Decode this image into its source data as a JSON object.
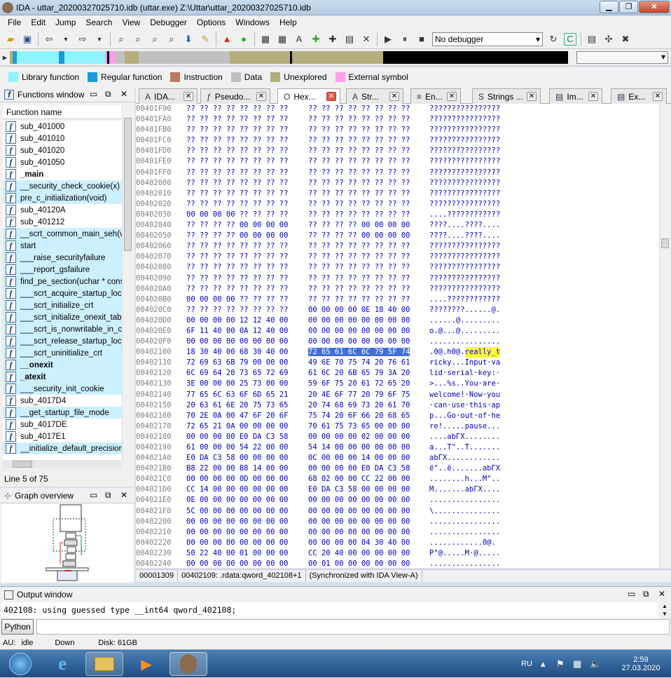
{
  "window": {
    "title": "IDA - uttar_20200327025710.idb (uttar.exe) Z:\\Uttar\\uttar_20200327025710.idb",
    "minimize": "▁",
    "maximize": "❐",
    "close": "✕"
  },
  "menu": [
    "File",
    "Edit",
    "Jump",
    "Search",
    "View",
    "Debugger",
    "Options",
    "Windows",
    "Help"
  ],
  "toolbar": {
    "debugger": "No debugger"
  },
  "legend": [
    {
      "label": "Library function",
      "color": "#8ff3ff"
    },
    {
      "label": "Regular function",
      "color": "#1a9bdc"
    },
    {
      "label": "Instruction",
      "color": "#b87a62"
    },
    {
      "label": "Data",
      "color": "#c0c0c0"
    },
    {
      "label": "Unexplored",
      "color": "#b3ae7b"
    },
    {
      "label": "External symbol",
      "color": "#ff9ee8"
    }
  ],
  "functions_window": {
    "title": "Functions window",
    "column": "Function name",
    "line_count": "Line 5 of 75",
    "items": [
      {
        "name": "sub_401000",
        "bold": false,
        "lib": false
      },
      {
        "name": "sub_401010",
        "bold": false,
        "lib": false
      },
      {
        "name": "sub_401020",
        "bold": false,
        "lib": false
      },
      {
        "name": "sub_401050",
        "bold": false,
        "lib": false
      },
      {
        "name": "_main",
        "bold": true,
        "lib": false
      },
      {
        "name": "__security_check_cookie(x)",
        "bold": false,
        "lib": true
      },
      {
        "name": "pre_c_initialization(void)",
        "bold": false,
        "lib": true
      },
      {
        "name": "sub_40120A",
        "bold": false,
        "lib": false
      },
      {
        "name": "sub_401212",
        "bold": false,
        "lib": false
      },
      {
        "name": "__scrt_common_main_seh(void)",
        "bold": false,
        "lib": true
      },
      {
        "name": "start",
        "bold": false,
        "lib": true
      },
      {
        "name": "___raise_securityfailure",
        "bold": false,
        "lib": true
      },
      {
        "name": "___report_gsfailure",
        "bold": false,
        "lib": true
      },
      {
        "name": "find_pe_section(uchar * const",
        "bold": false,
        "lib": true
      },
      {
        "name": "___scrt_acquire_startup_lock",
        "bold": false,
        "lib": true
      },
      {
        "name": "___scrt_initialize_crt",
        "bold": false,
        "lib": true
      },
      {
        "name": "___scrt_initialize_onexit_tables",
        "bold": false,
        "lib": true
      },
      {
        "name": "___scrt_is_nonwritable_in_current",
        "bold": false,
        "lib": true
      },
      {
        "name": "___scrt_release_startup_lock",
        "bold": false,
        "lib": true
      },
      {
        "name": "___scrt_uninitialize_crt",
        "bold": false,
        "lib": true
      },
      {
        "name": "__onexit",
        "bold": true,
        "lib": true
      },
      {
        "name": "_atexit",
        "bold": true,
        "lib": true
      },
      {
        "name": "___security_init_cookie",
        "bold": false,
        "lib": true
      },
      {
        "name": "sub_4017D4",
        "bold": false,
        "lib": false
      },
      {
        "name": "__get_startup_file_mode",
        "bold": false,
        "lib": true
      },
      {
        "name": "sub_4017DE",
        "bold": false,
        "lib": false
      },
      {
        "name": "sub_4017E1",
        "bold": false,
        "lib": false
      },
      {
        "name": "__initialize_default_precision",
        "bold": false,
        "lib": true
      }
    ]
  },
  "graph_overview": {
    "title": "Graph overview"
  },
  "tabs": [
    {
      "label": "IDA...",
      "icon": "A"
    },
    {
      "label": "Pseudo...",
      "icon": "ƒ"
    },
    {
      "label": "Hex...",
      "icon": "O",
      "active": true
    },
    {
      "label": "Str...",
      "icon": "A"
    },
    {
      "label": "En...",
      "icon": "≡"
    },
    {
      "label": "Strings ...",
      "icon": "S"
    },
    {
      "label": "Im...",
      "icon": "▤"
    },
    {
      "label": "Ex...",
      "icon": "▤"
    }
  ],
  "hex": {
    "rows": [
      {
        "a": "00401F90",
        "h1": "?? ?? ?? ?? ?? ?? ?? ??",
        "h2": "?? ?? ?? ?? ?? ?? ?? ??",
        "asc": "????????????????"
      },
      {
        "a": "00401FA0",
        "h1": "?? ?? ?? ?? ?? ?? ?? ??",
        "h2": "?? ?? ?? ?? ?? ?? ?? ??",
        "asc": "????????????????"
      },
      {
        "a": "00401FB0",
        "h1": "?? ?? ?? ?? ?? ?? ?? ??",
        "h2": "?? ?? ?? ?? ?? ?? ?? ??",
        "asc": "????????????????"
      },
      {
        "a": "00401FC0",
        "h1": "?? ?? ?? ?? ?? ?? ?? ??",
        "h2": "?? ?? ?? ?? ?? ?? ?? ??",
        "asc": "????????????????"
      },
      {
        "a": "00401FD0",
        "h1": "?? ?? ?? ?? ?? ?? ?? ??",
        "h2": "?? ?? ?? ?? ?? ?? ?? ??",
        "asc": "????????????????"
      },
      {
        "a": "00401FE0",
        "h1": "?? ?? ?? ?? ?? ?? ?? ??",
        "h2": "?? ?? ?? ?? ?? ?? ?? ??",
        "asc": "????????????????"
      },
      {
        "a": "00401FF0",
        "h1": "?? ?? ?? ?? ?? ?? ?? ??",
        "h2": "?? ?? ?? ?? ?? ?? ?? ??",
        "asc": "????????????????"
      },
      {
        "a": "00402000",
        "h1": "?? ?? ?? ?? ?? ?? ?? ??",
        "h2": "?? ?? ?? ?? ?? ?? ?? ??",
        "asc": "????????????????"
      },
      {
        "a": "00402010",
        "h1": "?? ?? ?? ?? ?? ?? ?? ??",
        "h2": "?? ?? ?? ?? ?? ?? ?? ??",
        "asc": "????????????????"
      },
      {
        "a": "00402020",
        "h1": "?? ?? ?? ?? ?? ?? ?? ??",
        "h2": "?? ?? ?? ?? ?? ?? ?? ??",
        "asc": "????????????????"
      },
      {
        "a": "00402030",
        "h1": "00 00 00 00 ?? ?? ?? ??",
        "h2": "?? ?? ?? ?? ?? ?? ?? ??",
        "asc": "....????????????"
      },
      {
        "a": "00402040",
        "h1": "?? ?? ?? ?? 00 00 00 00",
        "h2": "?? ?? ?? ?? 00 00 00 00",
        "asc": "????....????...."
      },
      {
        "a": "00402050",
        "h1": "?? ?? ?? ?? 00 00 00 00",
        "h2": "?? ?? ?? ?? 00 00 00 00",
        "asc": "????....????...."
      },
      {
        "a": "00402060",
        "h1": "?? ?? ?? ?? ?? ?? ?? ??",
        "h2": "?? ?? ?? ?? ?? ?? ?? ??",
        "asc": "????????????????"
      },
      {
        "a": "00402070",
        "h1": "?? ?? ?? ?? ?? ?? ?? ??",
        "h2": "?? ?? ?? ?? ?? ?? ?? ??",
        "asc": "????????????????"
      },
      {
        "a": "00402080",
        "h1": "?? ?? ?? ?? ?? ?? ?? ??",
        "h2": "?? ?? ?? ?? ?? ?? ?? ??",
        "asc": "????????????????"
      },
      {
        "a": "00402090",
        "h1": "?? ?? ?? ?? ?? ?? ?? ??",
        "h2": "?? ?? ?? ?? ?? ?? ?? ??",
        "asc": "????????????????"
      },
      {
        "a": "004020A0",
        "h1": "?? ?? ?? ?? ?? ?? ?? ??",
        "h2": "?? ?? ?? ?? ?? ?? ?? ??",
        "asc": "????????????????"
      },
      {
        "a": "004020B0",
        "h1": "00 00 00 00 ?? ?? ?? ??",
        "h2": "?? ?? ?? ?? ?? ?? ?? ??",
        "asc": "....????????????"
      },
      {
        "a": "004020C0",
        "h1": "?? ?? ?? ?? ?? ?? ?? ??",
        "h2": "00 00 00 00 0E 18 40 00",
        "asc": "????????......@."
      },
      {
        "a": "004020D0",
        "h1": "00 00 00 00 12 12 40 00",
        "h2": "00 00 00 00 00 00 00 00",
        "asc": "......@........."
      },
      {
        "a": "004020E0",
        "h1": "6F 11 40 00 0A 12 40 00",
        "h2": "00 00 00 00 00 00 00 00",
        "asc": "o.@...@........."
      },
      {
        "a": "004020F0",
        "h1": "00 00 00 00 00 00 00 00",
        "h2": "00 00 00 00 00 00 00 00",
        "asc": "................"
      },
      {
        "a": "00402100",
        "h1": "18 30 40 00 68 30 40 00",
        "h2": "72 65 61 6C 6C 79 5F 74",
        "asc": ".0@.h0@.",
        "ascHl": "really_t",
        "sel": true
      },
      {
        "a": "00402110",
        "h1": "72 69 63 6B 79 00 00 00",
        "h2": "49 6E 70 75 74 20 76 61",
        "asc": "ricky...Input·va"
      },
      {
        "a": "00402120",
        "h1": "6C 69 64 20 73 65 72 69",
        "h2": "61 6C 20 6B 65 79 3A 20",
        "asc": "lid·serial·key:·"
      },
      {
        "a": "00402130",
        "h1": "3E 00 00 00 25 73 00 00",
        "h2": "59 6F 75 20 61 72 65 20",
        "asc": ">...%s..You·are·"
      },
      {
        "a": "00402140",
        "h1": "77 65 6C 63 6F 6D 65 21",
        "h2": "20 4E 6F 77 20 79 6F 75",
        "asc": "welcome!·Now·you"
      },
      {
        "a": "00402150",
        "h1": "20 63 61 6E 20 75 73 65",
        "h2": "20 74 68 69 73 20 61 70",
        "asc": "·can·use·this·ap"
      },
      {
        "a": "00402160",
        "h1": "70 2E 0A 00 47 6F 20 6F",
        "h2": "75 74 20 6F 66 20 68 65",
        "asc": "p...Go·out·of·he"
      },
      {
        "a": "00402170",
        "h1": "72 65 21 0A 00 00 00 00",
        "h2": "70 61 75 73 65 00 00 00",
        "asc": "re!.....pause..."
      },
      {
        "a": "00402180",
        "h1": "00 00 00 00 E0 DA C3 58",
        "h2": "00 00 00 00 02 00 00 00",
        "asc": "....abГX........"
      },
      {
        "a": "00402190",
        "h1": "61 00 00 00 54 22 00 00",
        "h2": "54 14 00 00 00 00 00 00",
        "asc": "a...T\"..T......."
      },
      {
        "a": "004021A0",
        "h1": "E0 DA C3 58 00 00 00 00",
        "h2": "0C 00 00 00 14 00 00 00",
        "asc": "abГX............"
      },
      {
        "a": "004021B0",
        "h1": "B8 22 00 00 B8 14 00 00",
        "h2": "00 00 00 00 E0 DA C3 58",
        "asc": "ё\"..ё.......abГX"
      },
      {
        "a": "004021C0",
        "h1": "00 00 00 00 0D 00 00 00",
        "h2": "68 02 00 00 CC 22 00 00",
        "asc": "........h...M\".."
      },
      {
        "a": "004021D0",
        "h1": "CC 14 00 00 00 00 00 00",
        "h2": "E0 DA C3 58 00 00 00 00",
        "asc": "M.......abГX...."
      },
      {
        "a": "004021E0",
        "h1": "0E 00 00 00 00 00 00 00",
        "h2": "00 00 00 00 00 00 00 00",
        "asc": "................"
      },
      {
        "a": "004021F0",
        "h1": "5C 00 00 00 00 00 00 00",
        "h2": "00 00 00 00 00 00 00 00",
        "asc": "\\..............."
      },
      {
        "a": "00402200",
        "h1": "00 00 00 00 00 00 00 00",
        "h2": "00 00 00 00 00 00 00 00",
        "asc": "................"
      },
      {
        "a": "00402210",
        "h1": "00 00 00 00 00 00 00 00",
        "h2": "00 00 00 00 00 00 00 00",
        "asc": "................"
      },
      {
        "a": "00402220",
        "h1": "00 00 00 00 00 00 00 00",
        "h2": "00 00 00 00 04 30 40 00",
        "asc": "............0@."
      },
      {
        "a": "00402230",
        "h1": "50 22 40 00 01 00 00 00",
        "h2": "CC 20 40 00 00 00 00 00",
        "asc": "P\"@.....M·@....."
      },
      {
        "a": "00402240",
        "h1": "00 00 00 00 00 00 00 00",
        "h2": "00 01 00 00 00 00 00 00",
        "asc": "................"
      }
    ]
  },
  "hex_status": [
    "00001309",
    "00402109: .rdata:qword_402108+1",
    "(Synchronized with IDA View-A)"
  ],
  "output": {
    "title": "Output window",
    "text": "402108: using guessed type __int64 qword_402108;",
    "python_button": "Python"
  },
  "status": {
    "au": "AU:",
    "au_state": "idle",
    "direction": "Down",
    "disk": "Disk: 61GB"
  },
  "taskbar": {
    "lang": "RU",
    "time": "2:59",
    "date": "27.03.2020"
  }
}
